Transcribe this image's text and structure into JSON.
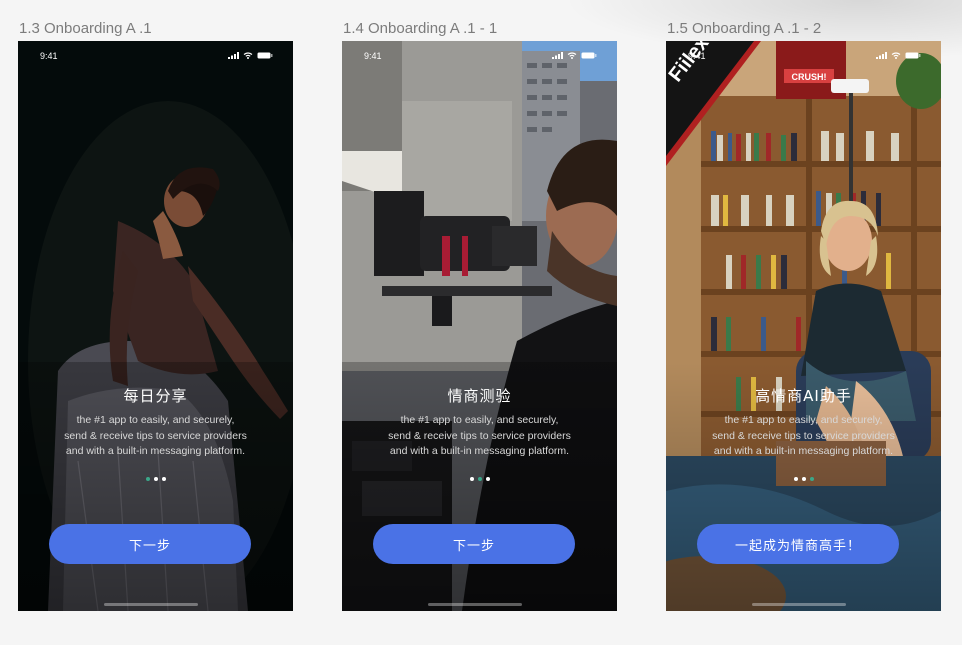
{
  "frames": [
    {
      "label": "1.3 Onboarding A .1",
      "time": "9:41",
      "title": "每日分享",
      "desc": [
        "the #1 app to easily, and securely,",
        "send & receive tips to service providers",
        "and with a built-in messaging platform."
      ],
      "cta": "下一步",
      "active_dot": 0
    },
    {
      "label": "1.4 Onboarding A .1 - 1",
      "time": "9:41",
      "title": "情商测验",
      "desc": [
        "the #1 app to easily, and securely,",
        "send & receive tips to service providers",
        "and with a built-in messaging platform."
      ],
      "cta": "下一步",
      "active_dot": 1
    },
    {
      "label": "1.5 Onboarding A .1 - 2",
      "time": "9:41",
      "title": "高情商AI助手",
      "desc": [
        "the #1 app to easily, and securely,",
        "send & receive tips to service providers",
        "and with a built-in messaging platform."
      ],
      "cta": "一起成为情商高手！",
      "active_dot": 2
    }
  ],
  "photo_text": {
    "flag": "Fiilex",
    "poster": "CRUSH!"
  },
  "colors": {
    "cta": "#4a72e6",
    "active_dot": "#3ba789",
    "label": "#7c7c7c"
  }
}
